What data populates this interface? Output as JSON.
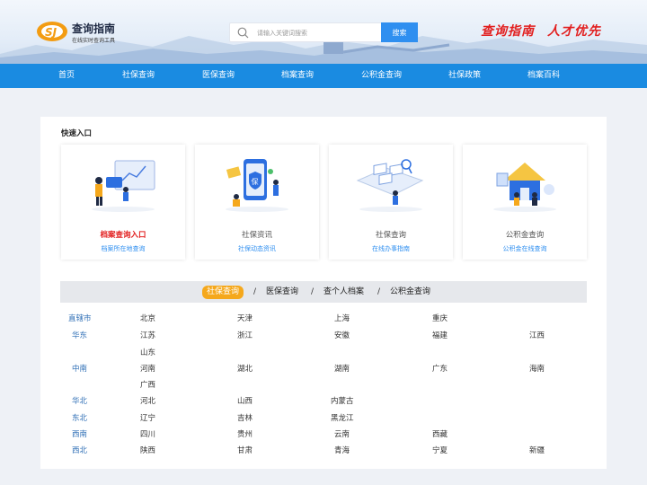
{
  "header": {
    "logo_title": "查询指南",
    "logo_subtitle": "在线实时查询工具",
    "search_placeholder": "请输入关键词搜索",
    "search_button": "搜索",
    "slogan_left": "查询指南",
    "slogan_right": "人才优先"
  },
  "nav": [
    "首页",
    "社保查询",
    "医保查询",
    "档案查询",
    "公积金查询",
    "社保政策",
    "档案百科"
  ],
  "quick": {
    "title": "快速入口",
    "cards": [
      {
        "title": "档案查询入口",
        "subtitle": "档案所在地查询"
      },
      {
        "title": "社保资讯",
        "subtitle": "社保动态资讯"
      },
      {
        "title": "社保查询",
        "subtitle": "在线办事指南"
      },
      {
        "title": "公积金查询",
        "subtitle": "公积金在线查询"
      }
    ]
  },
  "tabs": {
    "items": [
      "社保查询",
      "医保查询",
      "查个人档案",
      "公积金查询"
    ],
    "separator": "/",
    "active_index": 0
  },
  "regions": [
    {
      "name": "直辖市",
      "cities": [
        "北京",
        "天津",
        "上海",
        "重庆"
      ]
    },
    {
      "name": "华东",
      "cities": [
        "江苏",
        "浙江",
        "安徽",
        "福建",
        "江西",
        "山东"
      ]
    },
    {
      "name": "中南",
      "cities": [
        "河南",
        "湖北",
        "湖南",
        "广东",
        "海南",
        "广西"
      ]
    },
    {
      "name": "华北",
      "cities": [
        "河北",
        "山西",
        "内蒙古"
      ]
    },
    {
      "name": "东北",
      "cities": [
        "辽宁",
        "吉林",
        "黑龙江"
      ]
    },
    {
      "name": "西南",
      "cities": [
        "四川",
        "贵州",
        "云南",
        "西藏"
      ]
    },
    {
      "name": "西北",
      "cities": [
        "陕西",
        "甘肃",
        "青海",
        "宁夏",
        "新疆"
      ]
    }
  ],
  "colors": {
    "nav_blue": "#1a8be1",
    "accent_blue": "#2f8ff0",
    "slogan_red": "#e21f1f",
    "tab_active": "#f5a81c",
    "region_blue": "#2f6fb6"
  }
}
